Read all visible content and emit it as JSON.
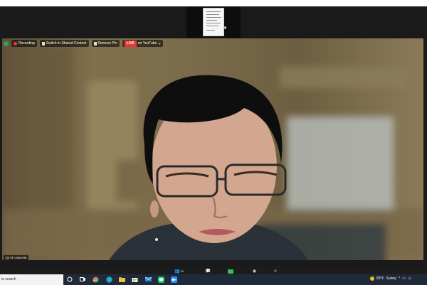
{
  "meeting": {
    "toolbar": {
      "recording_label": "Recording",
      "switch_label": "Switch to Shared Content",
      "remove_pin_label": "Remove Pin",
      "live_badge": "LIVE",
      "live_platform": "on YouTube"
    },
    "participant": {
      "name": "VE LINA KIM"
    },
    "bottom_bar": {
      "left_label": "tio",
      "participants_label": "Participants",
      "participants_count": "25",
      "chat_label": "Chat",
      "share_label": "Share Screen",
      "record_label": "Record",
      "reactions_label": "Reactions"
    }
  },
  "taskbar": {
    "search_text": "to search",
    "apps": [
      "task-view-icon",
      "chrome-icon",
      "edge-icon",
      "file-explorer-icon",
      "store-icon",
      "mail-icon",
      "line-icon",
      "zoom-icon"
    ],
    "weather": {
      "temp": "83°F",
      "condition": "Sunny"
    }
  },
  "colors": {
    "accent_green": "#3dbd4e",
    "record_red": "#e53935",
    "taskbar": "#1e2a3a"
  }
}
